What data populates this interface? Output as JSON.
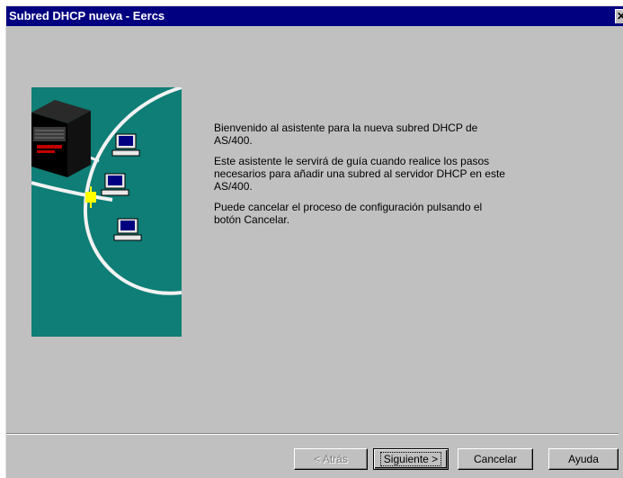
{
  "window": {
    "title": "Subred DHCP nueva - Eercs",
    "close_glyph": "✕"
  },
  "welcome": {
    "paragraph1": "Bienvenido al asistente para la nueva subred DHCP de AS/400.",
    "paragraph2": "Este asistente le servirá de guía cuando realice los pasos necesarios para añadir una subred al servidor DHCP en este AS/400.",
    "paragraph3": "Puede cancelar el proceso de configuración pulsando el botón Cancelar."
  },
  "buttons": {
    "back": "< Atrás",
    "next": "Siguiente >",
    "cancel": "Cancelar",
    "help": "Ayuda"
  },
  "colors": {
    "titlebar": "#000080",
    "dialog_bg": "#c0c0c0",
    "illustration_bg": "#0e7e76",
    "network_line": "#f2f2f2",
    "connector": "#ffff00",
    "server_red": "#c00000"
  },
  "icons": {
    "server": "server-icon",
    "computer": "computer-icon",
    "connector": "network-connector-icon",
    "close": "close-icon"
  }
}
